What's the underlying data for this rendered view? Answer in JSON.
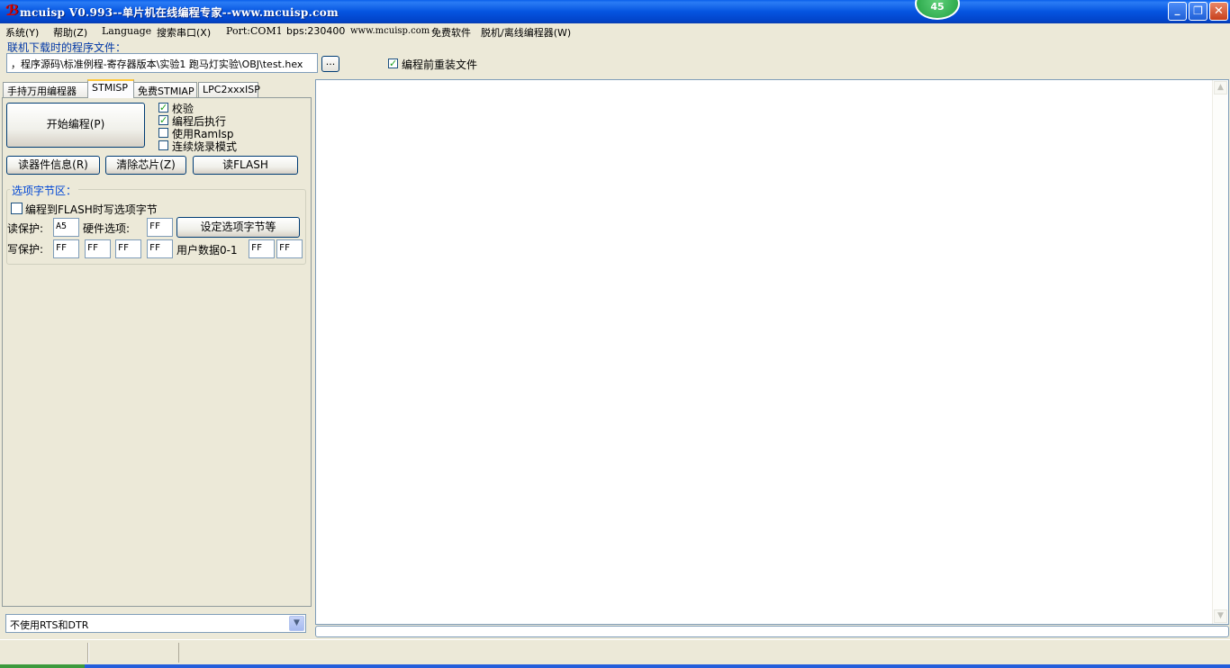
{
  "window": {
    "title": "mcuisp V0.993--单片机在线编程专家--www.mcuisp.com",
    "app_icon_glyph": "ℬ",
    "badge": "45",
    "minimize": "_",
    "maximize": "❐",
    "close": "✕"
  },
  "menu": {
    "items": [
      "系统(Y)",
      "帮助(Z)",
      "Language",
      "搜索串口(X)",
      "Port:COM1",
      "bps:230400",
      "www.mcuisp.com",
      "免费软件",
      "脱机/离线编程器(W)"
    ]
  },
  "file": {
    "label": "联机下载时的程序文件：",
    "path": "，程序源码\\标准例程-寄存器版本\\实验1 跑马灯实验\\OBJ\\test.hex",
    "browse": "...",
    "reload_label": "编程前重装文件",
    "reload_checked": true
  },
  "tabs": [
    "手持万用编程器",
    "STMISP",
    "免费STMIAP",
    "LPC2xxxISP"
  ],
  "stmisp": {
    "start_button": "开始编程(P)",
    "options": [
      {
        "label": "校验",
        "checked": true
      },
      {
        "label": "编程后执行",
        "checked": true
      },
      {
        "label": "使用RamIsp",
        "checked": false
      },
      {
        "label": "连续烧录模式",
        "checked": false
      }
    ],
    "read_info_button": "读器件信息(R)",
    "erase_button": "清除芯片(Z)",
    "read_flash_button": "读FLASH",
    "option_group": {
      "legend": "选项字节区：",
      "write_on_program_label": "编程到FLASH时写选项字节",
      "write_on_program_checked": false,
      "read_protect_label": "读保护:",
      "read_protect_value": "A5",
      "hw_option_label": "硬件选项:",
      "hw_option_value": "FF",
      "set_option_button": "设定选项字节等",
      "write_protect_label": "写保护:",
      "write_protect_values": [
        "FF",
        "FF",
        "FF",
        "FF"
      ],
      "user_data_label": "用户数据0-1",
      "user_data_values": [
        "FF",
        "FF"
      ]
    },
    "rts_dtr_select": "不使用RTS和DTR"
  },
  "check_glyph": "✓",
  "scroll": {
    "up": "▲",
    "down": "▼"
  },
  "select_arrow": "▼"
}
